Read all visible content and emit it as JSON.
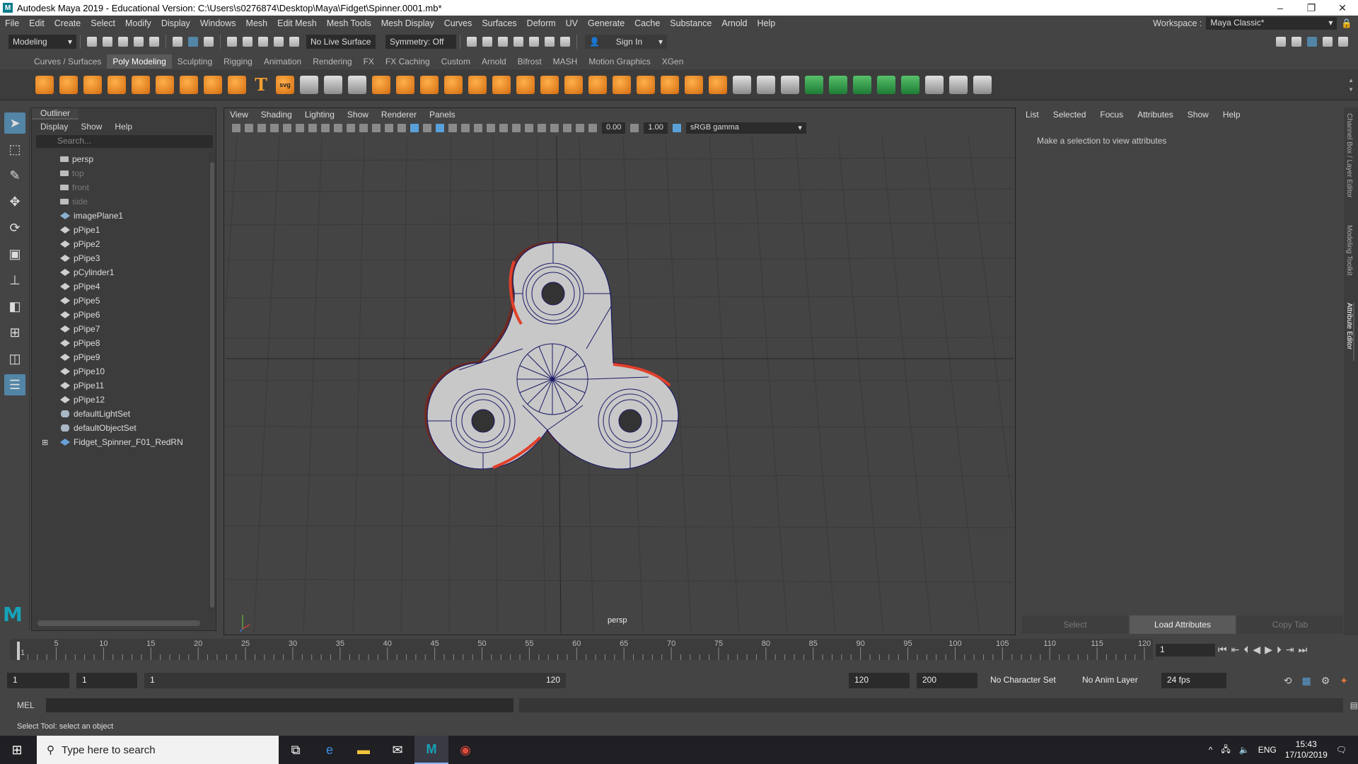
{
  "window": {
    "title": "Autodesk Maya 2019 - Educational Version: C:\\Users\\s0276874\\Desktop\\Maya\\Fidget\\Spinner.0001.mb*",
    "controls": [
      "–",
      "❐",
      "✕"
    ]
  },
  "menubar": {
    "items": [
      "File",
      "Edit",
      "Create",
      "Select",
      "Modify",
      "Display",
      "Windows",
      "Mesh",
      "Edit Mesh",
      "Mesh Tools",
      "Mesh Display",
      "Curves",
      "Surfaces",
      "Deform",
      "UV",
      "Generate",
      "Cache",
      "Substance",
      "Arnold",
      "Help"
    ],
    "workspace_label": "Workspace :",
    "workspace_value": "Maya Classic*"
  },
  "statusline": {
    "mode": "Modeling",
    "live_surface": "No Live Surface",
    "symmetry": "Symmetry: Off",
    "sign_in": "Sign In"
  },
  "shelf": {
    "tabs": [
      "Curves / Surfaces",
      "Poly Modeling",
      "Sculpting",
      "Rigging",
      "Animation",
      "Rendering",
      "FX",
      "FX Caching",
      "Custom",
      "Arnold",
      "Bifrost",
      "MASH",
      "Motion Graphics",
      "XGen"
    ],
    "active_tab": "Poly Modeling",
    "text_icon": "T",
    "svg_icon": "svg"
  },
  "outliner": {
    "title": "Outliner",
    "menu": [
      "Display",
      "Show",
      "Help"
    ],
    "search_placeholder": "Search...",
    "items": [
      {
        "label": "persp",
        "icon": "camera-icon",
        "dim": false
      },
      {
        "label": "top",
        "icon": "camera-icon",
        "dim": true
      },
      {
        "label": "front",
        "icon": "camera-icon",
        "dim": true
      },
      {
        "label": "side",
        "icon": "camera-icon",
        "dim": true
      },
      {
        "label": "imagePlane1",
        "icon": "image-plane-icon",
        "dim": false
      },
      {
        "label": "pPipe1",
        "icon": "transform-icon",
        "dim": false
      },
      {
        "label": "pPipe2",
        "icon": "transform-icon",
        "dim": false
      },
      {
        "label": "pPipe3",
        "icon": "transform-icon",
        "dim": false
      },
      {
        "label": "pCylinder1",
        "icon": "transform-icon",
        "dim": false
      },
      {
        "label": "pPipe4",
        "icon": "transform-icon",
        "dim": false
      },
      {
        "label": "pPipe5",
        "icon": "transform-icon",
        "dim": false
      },
      {
        "label": "pPipe6",
        "icon": "transform-icon",
        "dim": false
      },
      {
        "label": "pPipe7",
        "icon": "transform-icon",
        "dim": false
      },
      {
        "label": "pPipe8",
        "icon": "transform-icon",
        "dim": false
      },
      {
        "label": "pPipe9",
        "icon": "transform-icon",
        "dim": false
      },
      {
        "label": "pPipe10",
        "icon": "transform-icon",
        "dim": false
      },
      {
        "label": "pPipe11",
        "icon": "transform-icon",
        "dim": false
      },
      {
        "label": "pPipe12",
        "icon": "transform-icon",
        "dim": false
      },
      {
        "label": "defaultLightSet",
        "icon": "set-icon",
        "dim": false
      },
      {
        "label": "defaultObjectSet",
        "icon": "set-icon",
        "dim": false
      },
      {
        "label": "Fidget_Spinner_F01_RedRN",
        "icon": "reference-icon",
        "dim": false,
        "expandable": true
      }
    ]
  },
  "viewport": {
    "menu": [
      "View",
      "Shading",
      "Lighting",
      "Show",
      "Renderer",
      "Panels"
    ],
    "value_a": "0.00",
    "value_b": "1.00",
    "color_space": "sRGB gamma",
    "camera_label": "persp"
  },
  "attribute_editor": {
    "menu": [
      "List",
      "Selected",
      "Focus",
      "Attributes",
      "Show",
      "Help"
    ],
    "message": "Make a selection to view attributes",
    "buttons": [
      "Select",
      "Load Attributes",
      "Copy Tab"
    ],
    "side_tabs": [
      "Channel Box / Layer Editor",
      "Modeling Toolkit",
      "Attribute Editor"
    ]
  },
  "timeline": {
    "tick_labels": [
      "1",
      "5",
      "10",
      "15",
      "20",
      "25",
      "30",
      "35",
      "40",
      "45",
      "50",
      "55",
      "60",
      "65",
      "70",
      "75",
      "80",
      "85",
      "90",
      "95",
      "100",
      "105",
      "110",
      "115",
      "120"
    ],
    "current_frame": "1"
  },
  "range": {
    "start": "1",
    "playback_start": "1",
    "slider_start": "1",
    "slider_end": "120",
    "playback_end": "120",
    "end": "200",
    "character_set": "No Character Set",
    "anim_layer": "No Anim Layer",
    "fps": "24 fps"
  },
  "command": {
    "label": "MEL",
    "help": "Select Tool: select an object"
  },
  "taskbar": {
    "search_placeholder": "Type here to search",
    "lang": "ENG",
    "time": "15:43",
    "date": "17/10/2019"
  }
}
